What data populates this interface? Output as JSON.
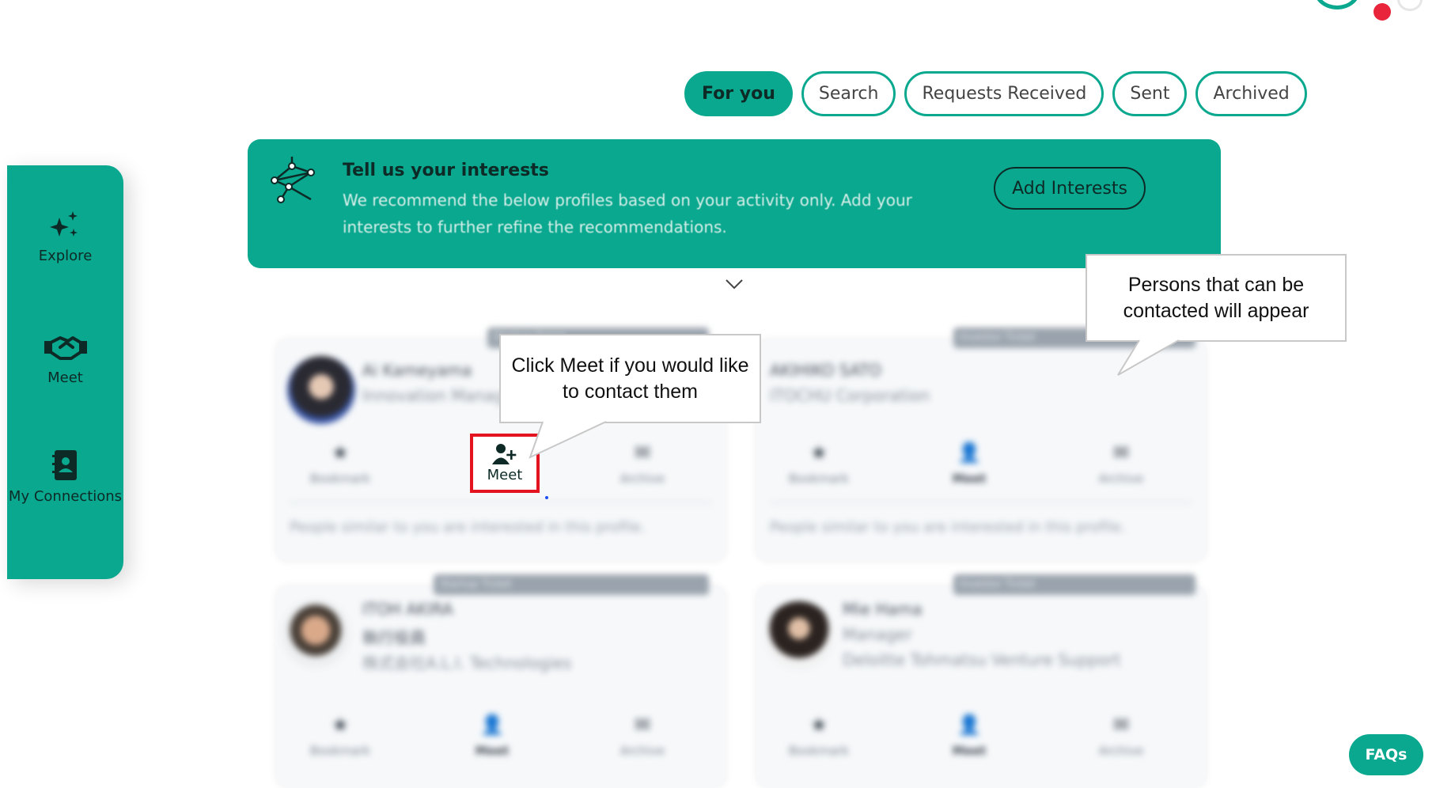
{
  "tabs": [
    {
      "label": "For you",
      "active": true
    },
    {
      "label": "Search",
      "active": false
    },
    {
      "label": "Requests Received",
      "active": false
    },
    {
      "label": "Sent",
      "active": false
    },
    {
      "label": "Archived",
      "active": false
    }
  ],
  "sidebar": {
    "items": [
      {
        "label": "Explore",
        "icon": "sparkles-icon"
      },
      {
        "label": "Meet",
        "icon": "handshake-icon"
      },
      {
        "label": "My Connections",
        "icon": "contacts-book-icon"
      }
    ]
  },
  "banner": {
    "title": "Tell us your interests",
    "text": "We recommend the below profiles based on your activity only. Add your interests to further refine the recommendations.",
    "button": "Add Interests"
  },
  "cards": [
    {
      "tag": "Startup Ticket",
      "name": "Ai Kameyama",
      "title": "Innovation Manager",
      "company": "",
      "actions": {
        "bookmark": "Bookmark",
        "meet": "Meet",
        "archive": "Archive"
      },
      "reason": "People similar to you are interested in this profile."
    },
    {
      "tag": "Investor Ticket",
      "name": "AKIHIKO SATO",
      "title": "ITOCHU Corporation",
      "company": "",
      "actions": {
        "bookmark": "Bookmark",
        "meet": "Meet",
        "archive": "Archive"
      },
      "reason": "People similar to you are interested in this profile."
    },
    {
      "tag": "Startup Ticket",
      "name": "ITOH AKIRA",
      "title": "執行役員",
      "company": "株式会社A.L.I. Technologies",
      "actions": {
        "bookmark": "Bookmark",
        "meet": "Meet",
        "archive": "Archive"
      },
      "reason": ""
    },
    {
      "tag": "Investor Ticket",
      "name": "Mie Hama",
      "title": "Manager",
      "company": "Deloitte Tohmatsu Venture Support",
      "actions": {
        "bookmark": "Bookmark",
        "meet": "Meet",
        "archive": "Archive"
      },
      "reason": ""
    }
  ],
  "callouts": {
    "meet_hint": "Click  Meet if you would like to contact them",
    "persons_hint": "Persons that can be contacted will appear"
  },
  "faq_label": "FAQs",
  "colors": {
    "accent": "#0aa88f",
    "highlight": "#e3141f",
    "dark": "#0d2a26"
  }
}
